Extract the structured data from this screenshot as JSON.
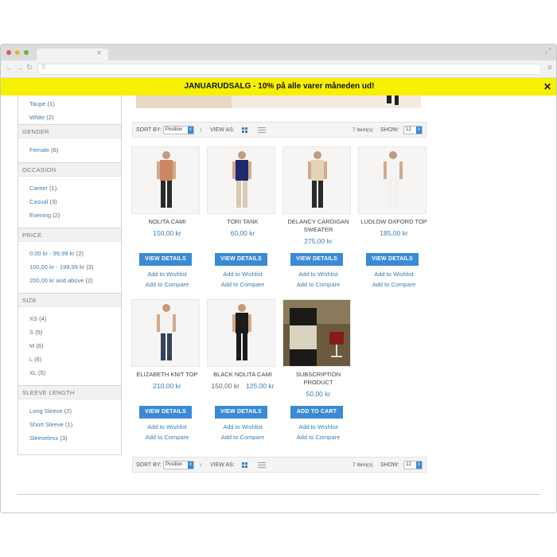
{
  "banner": {
    "text": "JANUARUDSALG - 10% på alle varer måneden ud!",
    "close": "✕"
  },
  "sidebar": {
    "top_items": [
      {
        "label": "Taupe",
        "count": "(1)"
      },
      {
        "label": "White",
        "count": "(2)"
      }
    ],
    "sections": [
      {
        "title": "GENDER",
        "items": [
          {
            "label": "Female",
            "count": "(6)"
          }
        ]
      },
      {
        "title": "OCCASION",
        "items": [
          {
            "label": "Career",
            "count": "(1)"
          },
          {
            "label": "Casual",
            "count": "(3)"
          },
          {
            "label": "Evening",
            "count": "(2)"
          }
        ]
      },
      {
        "title": "PRICE",
        "items": [
          {
            "label": "0,00 kr - 99,99 kr",
            "count": "(2)"
          },
          {
            "label": "100,00 kr - 199,99 kr",
            "count": "(3)"
          },
          {
            "label": "200,00 kr and above",
            "count": "(2)"
          }
        ]
      },
      {
        "title": "SIZE",
        "items": [
          {
            "label": "XS",
            "count": "(4)"
          },
          {
            "label": "S",
            "count": "(5)"
          },
          {
            "label": "M",
            "count": "(6)"
          },
          {
            "label": "L",
            "count": "(6)"
          },
          {
            "label": "XL",
            "count": "(5)"
          }
        ]
      },
      {
        "title": "SLEEVE LENGTH",
        "items": [
          {
            "label": "Long Sleeve",
            "count": "(2)"
          },
          {
            "label": "Short Sleeve",
            "count": "(1)"
          },
          {
            "label": "Sleeveless",
            "count": "(3)"
          }
        ]
      }
    ]
  },
  "toolbar": {
    "sort_label": "SORT BY:",
    "sort_value": "Position",
    "view_label": "VIEW AS:",
    "items_count": "7 Item(s)",
    "show_label": "SHOW:",
    "show_value": "12"
  },
  "products": [
    {
      "name": "NOLITA CAMI",
      "price": "150,00 kr",
      "old_price": "",
      "button": "VIEW DETAILS",
      "top_color": "#c98863",
      "bottom_color": "#2a2a2a"
    },
    {
      "name": "TORI TANK",
      "price": "60,00 kr",
      "old_price": "",
      "button": "VIEW DETAILS",
      "top_color": "#1e2a6e",
      "bottom_color": "#d7cbb6"
    },
    {
      "name": "DELANCY CARDIGAN SWEATER",
      "price": "275,00 kr",
      "old_price": "",
      "button": "VIEW DETAILS",
      "top_color": "#e4d3b7",
      "bottom_color": "#2a2a2a"
    },
    {
      "name": "LUDLOW OXFORD TOP",
      "price": "185,00 kr",
      "old_price": "",
      "button": "VIEW DETAILS",
      "top_color": "#f4f4f4",
      "bottom_color": "#f0f0f0"
    },
    {
      "name": "ELIZABETH KNIT TOP",
      "price": "210,00 kr",
      "old_price": "",
      "button": "VIEW DETAILS",
      "top_color": "#f2f2f2",
      "bottom_color": "#34425a"
    },
    {
      "name": "BLACK NOLITA CAMI",
      "price": "125,00 kr",
      "old_price": "150,00 kr",
      "button": "VIEW DETAILS",
      "top_color": "#1c1c1c",
      "bottom_color": "#1c1c1c"
    },
    {
      "name": "SUBSCRIPTION PRODUCT",
      "price": "50,00 kr",
      "old_price": "",
      "button": "ADD TO CART",
      "top_color": "#3a3020",
      "bottom_color": "#7a1818"
    }
  ],
  "links": {
    "wishlist": "Add to Wishlist",
    "compare": "Add to Compare"
  },
  "colors": {
    "accent": "#3b8ad6",
    "link": "#3a7fb6",
    "banner": "#f7f000"
  }
}
